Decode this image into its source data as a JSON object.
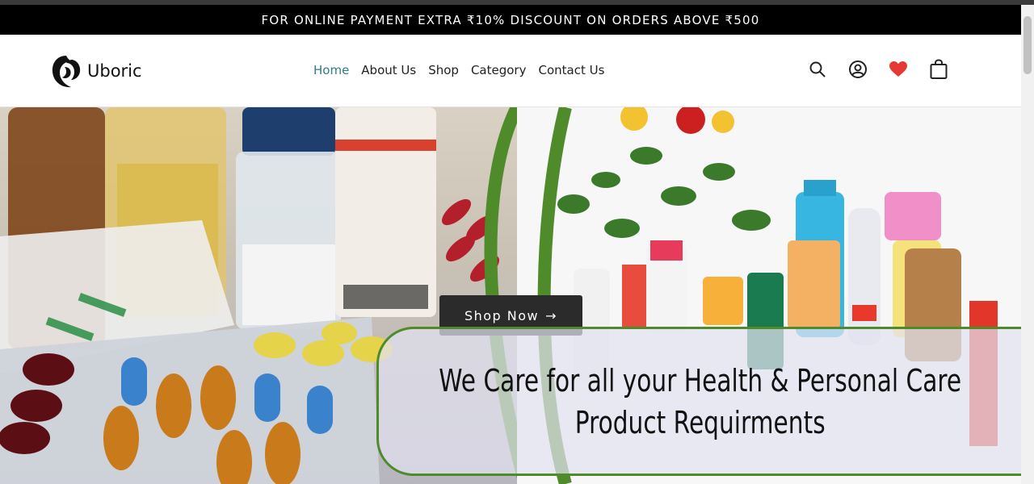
{
  "announcement": {
    "text": "FOR ONLINE PAYMENT EXTRA ₹10% DISCOUNT ON ORDERS ABOVE ₹500"
  },
  "logo": {
    "text": "Uboric"
  },
  "nav": {
    "items": [
      {
        "label": "Home",
        "active": true
      },
      {
        "label": "About Us"
      },
      {
        "label": "Shop"
      },
      {
        "label": "Category"
      },
      {
        "label": "Contact Us"
      }
    ]
  },
  "header_icons": [
    "search-icon",
    "account-icon",
    "wishlist-heart-icon",
    "cart-bag-icon"
  ],
  "hero": {
    "button_label": "Shop Now",
    "caption_line1": "We Care for all your Health & Personal Care",
    "caption_line2": "Product Requirments"
  },
  "colors": {
    "accent": "#2e7d8c",
    "green": "#4f8b2a",
    "heart": "#e53935"
  }
}
